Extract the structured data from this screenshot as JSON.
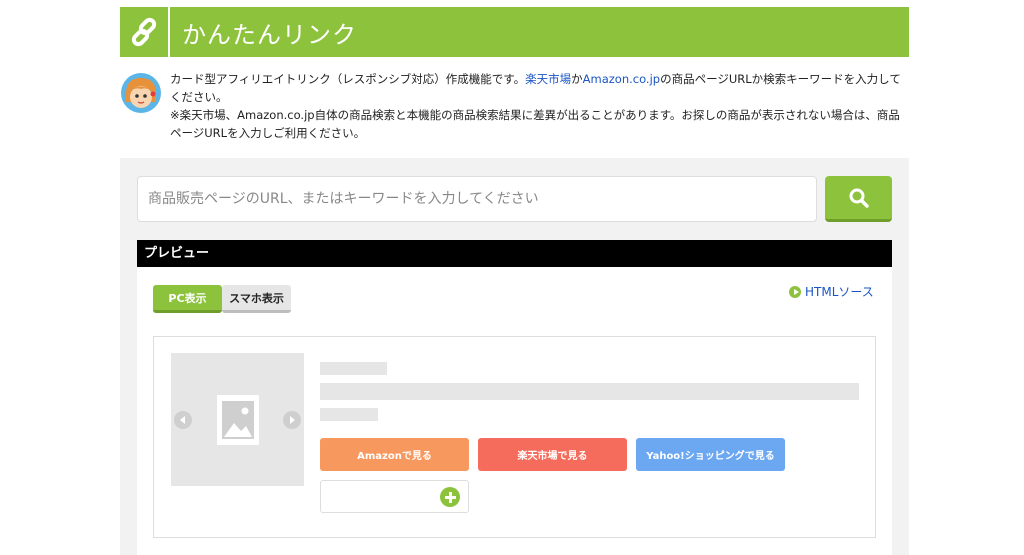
{
  "header": {
    "title": "かんたんリンク"
  },
  "intro": {
    "part1": "カード型アフィリエイトリンク（レスポンシブ対応）作成機能です。",
    "rakuten_link": "楽天市場",
    "connector": "か",
    "amazon_link": "Amazon.co.jp",
    "part2": "の商品ページURLか検索キーワードを入力してください。",
    "note": "※楽天市場、Amazon.co.jp自体の商品検索と本機能の商品検索結果に差異が出ることがあります。お探しの商品が表示されない場合は、商品ページURLを入力しご利用ください。"
  },
  "search": {
    "placeholder": "商品販売ページのURL、またはキーワードを入力してください",
    "value": ""
  },
  "preview": {
    "title": "プレビュー",
    "tabs": [
      {
        "label": "PC表示",
        "active": true
      },
      {
        "label": "スマホ表示",
        "active": false
      }
    ],
    "html_source_label": "HTMLソース"
  },
  "card": {
    "buttons": {
      "amazon": "Amazonで見る",
      "rakuten": "楽天市場で見る",
      "yahoo": "Yahoo!ショッピングで見る"
    }
  },
  "colors": {
    "brand": "#8dc23d",
    "amazon": "#f7985f",
    "rakuten": "#f56c5c",
    "yahoo": "#6ca7f2",
    "link": "#1a55c6"
  },
  "icons": {
    "logo": "chain-link-icon",
    "search": "search-icon",
    "html_source": "play-circle-icon",
    "image": "image-placeholder-icon",
    "prev": "arrow-left-icon",
    "next": "arrow-right-icon",
    "add": "plus-circle-icon"
  }
}
